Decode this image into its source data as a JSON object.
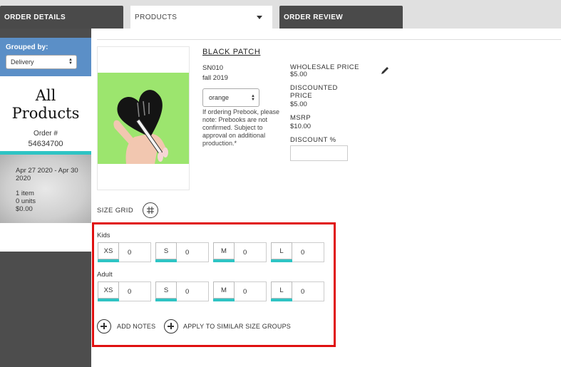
{
  "tabs": [
    {
      "label": "ORDER DETAILS"
    },
    {
      "label": "PRODUCTS"
    },
    {
      "label": "ORDER REVIEW"
    }
  ],
  "sidebar": {
    "grouped_by_label": "Grouped by:",
    "grouped_by_value": "Delivery",
    "title_line1": "All",
    "title_line2": "Products",
    "order_label": "Order #",
    "order_number": "54634700",
    "date_range_line1": "Apr 27 2020 - Apr 30",
    "date_range_line2": "2020",
    "items": "1 item",
    "units": "0 units",
    "total": "$0.00"
  },
  "product": {
    "title": "BLACK PATCH",
    "sku": "SN010",
    "season": "fall 2019",
    "color_value": "orange",
    "prebook_note": "If ordering Prebook, please note: Prebooks are not confirmed. Subject to approval on additional production.*",
    "wholesale_label": "WHOLESALE PRICE",
    "wholesale_value": "$5.00",
    "discounted_label_1": "DISCOUNTED",
    "discounted_label_2": "PRICE",
    "discounted_value": "$5.00",
    "msrp_label": "MSRP",
    "msrp_value": "$10.00",
    "discount_pct_label": "DISCOUNT %"
  },
  "size_grid": {
    "label": "SIZE GRID",
    "groups": [
      {
        "name": "Kids",
        "sizes": [
          {
            "size": "XS",
            "qty": "0"
          },
          {
            "size": "S",
            "qty": "0"
          },
          {
            "size": "M",
            "qty": "0"
          },
          {
            "size": "L",
            "qty": "0"
          }
        ]
      },
      {
        "name": "Adult",
        "sizes": [
          {
            "size": "XS",
            "qty": "0"
          },
          {
            "size": "S",
            "qty": "0"
          },
          {
            "size": "M",
            "qty": "0"
          },
          {
            "size": "L",
            "qty": "0"
          }
        ]
      }
    ],
    "add_notes_label": "ADD NOTES",
    "apply_similar_label": "APPLY TO SIMILAR SIZE GROUPS"
  },
  "colors": {
    "accent_teal": "#2ec4c4",
    "sidebar_blue": "#5b8fc7",
    "highlight_red": "#e01010"
  }
}
